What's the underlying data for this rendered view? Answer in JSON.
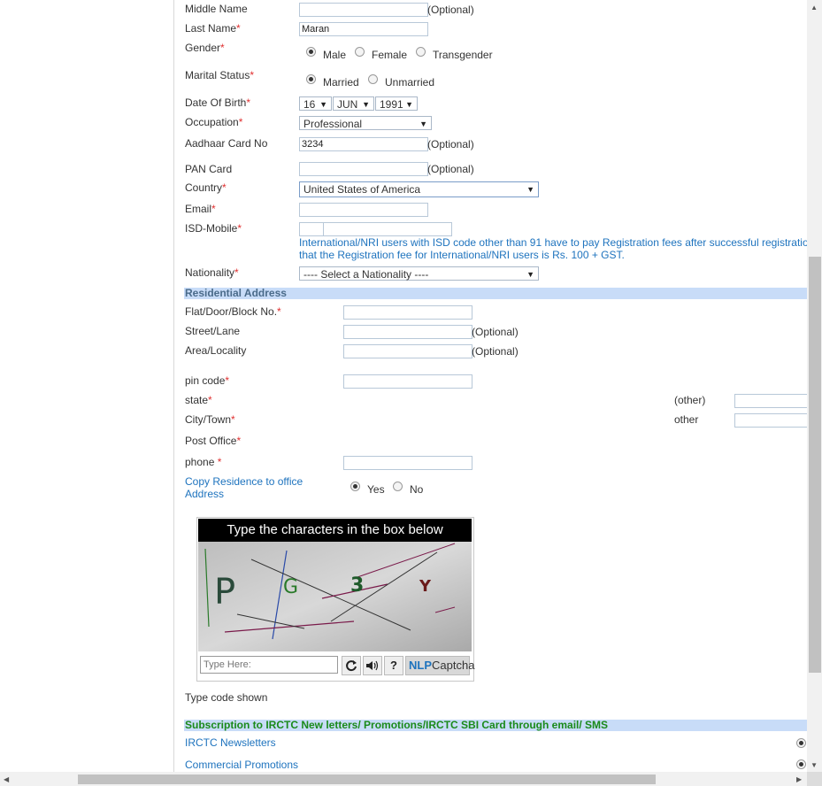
{
  "form": {
    "middle_name": {
      "label": "Middle Name",
      "value": "",
      "optional": "(Optional)"
    },
    "last_name": {
      "label": "Last Name",
      "value": "Maran"
    },
    "gender": {
      "label": "Gender",
      "options": [
        "Male",
        "Female",
        "Transgender"
      ],
      "selected": "Male"
    },
    "marital_status": {
      "label": "Marital Status",
      "options": [
        "Married",
        "Unmarried"
      ],
      "selected": "Married"
    },
    "dob": {
      "label": "Date Of Birth",
      "day": "16",
      "month": "JUN",
      "year": "1991"
    },
    "occupation": {
      "label": "Occupation",
      "value": "Professional"
    },
    "aadhaar": {
      "label": "Aadhaar Card No",
      "value": "3234",
      "optional": "(Optional)"
    },
    "pan": {
      "label": "PAN Card",
      "value": "",
      "optional": "(Optional)"
    },
    "country": {
      "label": "Country",
      "value": "United States of America"
    },
    "email": {
      "label": "Email",
      "value": ""
    },
    "isd_mobile": {
      "label": "ISD-Mobile",
      "isd": "",
      "mobile": "",
      "note_line1": "International/NRI users with ISD code other than 91 have to pay Registration fees after successful registratio",
      "note_line2": "that the Registration fee for International/NRI users is Rs. 100 + GST."
    },
    "nationality": {
      "label": "Nationality",
      "value": "---- Select a Nationality ----"
    }
  },
  "residential": {
    "title": "Residential Address",
    "flat": {
      "label": "Flat/Door/Block No.",
      "value": ""
    },
    "street": {
      "label": "Street/Lane",
      "value": "",
      "optional": "(Optional)"
    },
    "area": {
      "label": "Area/Locality",
      "value": "",
      "optional": "(Optional)"
    },
    "pin": {
      "label": "pin code",
      "value": ""
    },
    "state": {
      "label": "state",
      "other_label": "(other)",
      "other_value": ""
    },
    "city": {
      "label": "City/Town",
      "other_label": "other",
      "other_value": ""
    },
    "post_office": {
      "label": "Post Office"
    },
    "phone": {
      "label": "phone",
      "value": ""
    },
    "copy": {
      "label_line1": "Copy Residence to office",
      "label_line2": "Address",
      "options": [
        "Yes",
        "No"
      ],
      "selected": "Yes"
    }
  },
  "captcha": {
    "header": "Type the characters in the box below",
    "chars": [
      "P",
      "G",
      "3",
      "Y"
    ],
    "placeholder": "Type Here:",
    "refresh_icon": "refresh-icon",
    "audio_icon": "speaker-icon",
    "help_label": "?",
    "brand_n": "NLP",
    "brand_c": "Captcha",
    "caption": "Type code shown"
  },
  "subscription": {
    "title": "Subscription to IRCTC New letters/ Promotions/IRCTC SBI Card through email/ SMS",
    "items": [
      "IRCTC Newsletters",
      "Commercial Promotions"
    ]
  },
  "colors": {
    "required": "#e03030",
    "link_blue": "#1e73be",
    "section_bg": "#c8dcf8",
    "sub_green": "#1a8a1a"
  }
}
